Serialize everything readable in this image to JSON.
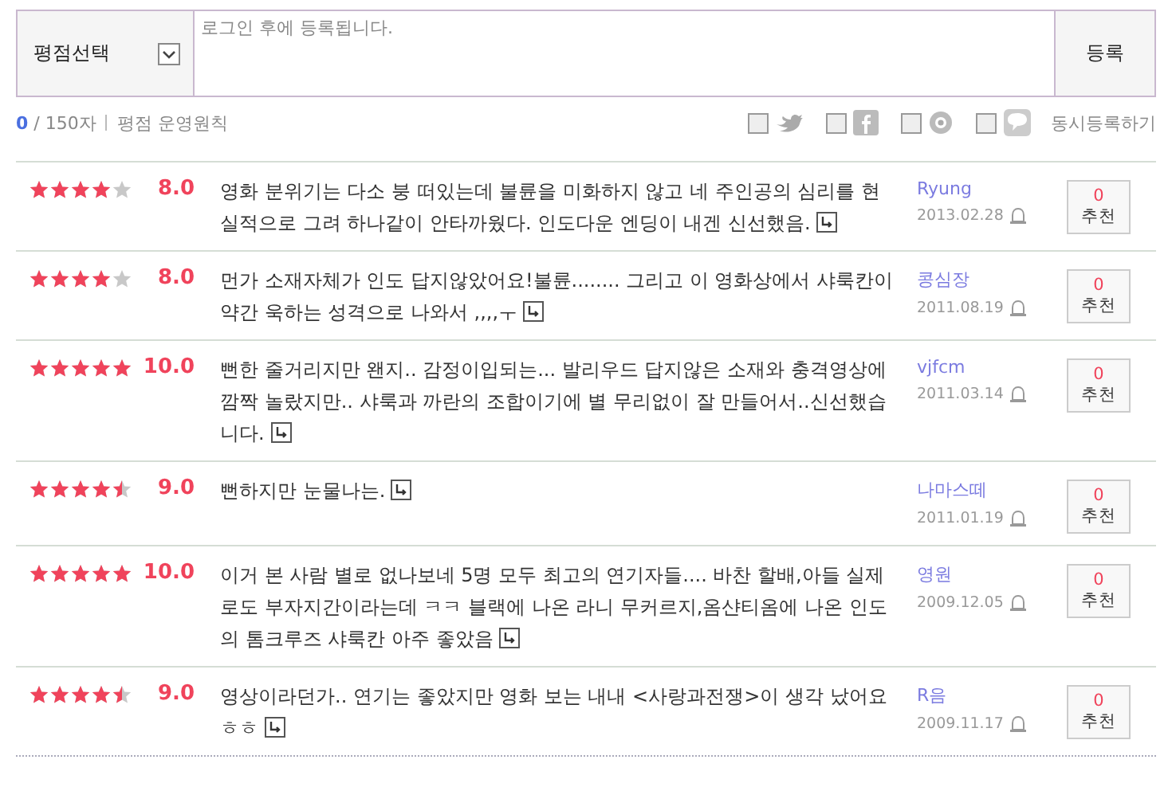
{
  "form": {
    "rating_select": {
      "label": "평점선택"
    },
    "comment_field": {
      "placeholder": "로그인 후에 등록됩니다."
    },
    "submit_button": "등록"
  },
  "counter": {
    "count": "0",
    "limit": "/ 150자"
  },
  "policy_link": "평점 운영원칙",
  "share_options": [
    {
      "kind": "twitter",
      "checked": false
    },
    {
      "kind": "facebook",
      "checked": false
    },
    {
      "kind": "circle",
      "checked": false
    },
    {
      "kind": "chat",
      "checked": false
    }
  ],
  "share_label": "동시등록하기",
  "reviews": [
    {
      "stars": 4,
      "score": "8.0",
      "text": "영화 분위기는 다소 붕 떠있는데 불륜을 미화하지 않고 네 주인공의 심리를 현실적으로 그려 하나같이 안타까웠다. 인도다운 엔딩이 내겐 신선했음.",
      "writer": "Ryung",
      "date": "2013.02.28",
      "recommend_count": "0",
      "recommend_label": "추천"
    },
    {
      "stars": 4,
      "score": "8.0",
      "text": "먼가 소재자체가 인도 답지않았어요!불륜........ 그리고 이 영화상에서 샤룩칸이 약간 욱하는 성격으로 나와서 ,,,,ㅜ",
      "writer": "콩심장",
      "date": "2011.08.19",
      "recommend_count": "0",
      "recommend_label": "추천"
    },
    {
      "stars": 5,
      "score": "10.0",
      "text": "뻔한 줄거리지만 왠지.. 감정이입되는... 발리우드 답지않은 소재와 충격영상에 깜짝 놀랐지만.. 샤룩과 까란의 조합이기에 별 무리없이 잘 만들어서..신선했습니다.",
      "writer": "vjfcm",
      "date": "2011.03.14",
      "recommend_count": "0",
      "recommend_label": "추천"
    },
    {
      "stars": 4.5,
      "score": "9.0",
      "text": "뻔하지만 눈물나는.",
      "writer": "나마스떼",
      "date": "2011.01.19",
      "recommend_count": "0",
      "recommend_label": "추천"
    },
    {
      "stars": 5,
      "score": "10.0",
      "text": "이거 본 사람 별로 없나보네 5명 모두 최고의 연기자들.... 바찬 할배,아들 실제로도 부자지간이라는데 ㅋㅋ 블랙에 나온 라니 무커르지,옴샨티옴에 나온 인도의 톰크루즈 샤룩칸 아주 좋았음",
      "writer": "영원",
      "date": "2009.12.05",
      "recommend_count": "0",
      "recommend_label": "추천"
    },
    {
      "stars": 4.5,
      "score": "9.0",
      "text": "영상이라던가.. 연기는 좋았지만 영화 보는 내내 <사랑과전쟁>이 생각 났어요 ㅎㅎ",
      "writer": "R음",
      "date": "2009.11.17",
      "recommend_count": "0",
      "recommend_label": "추천"
    }
  ]
}
